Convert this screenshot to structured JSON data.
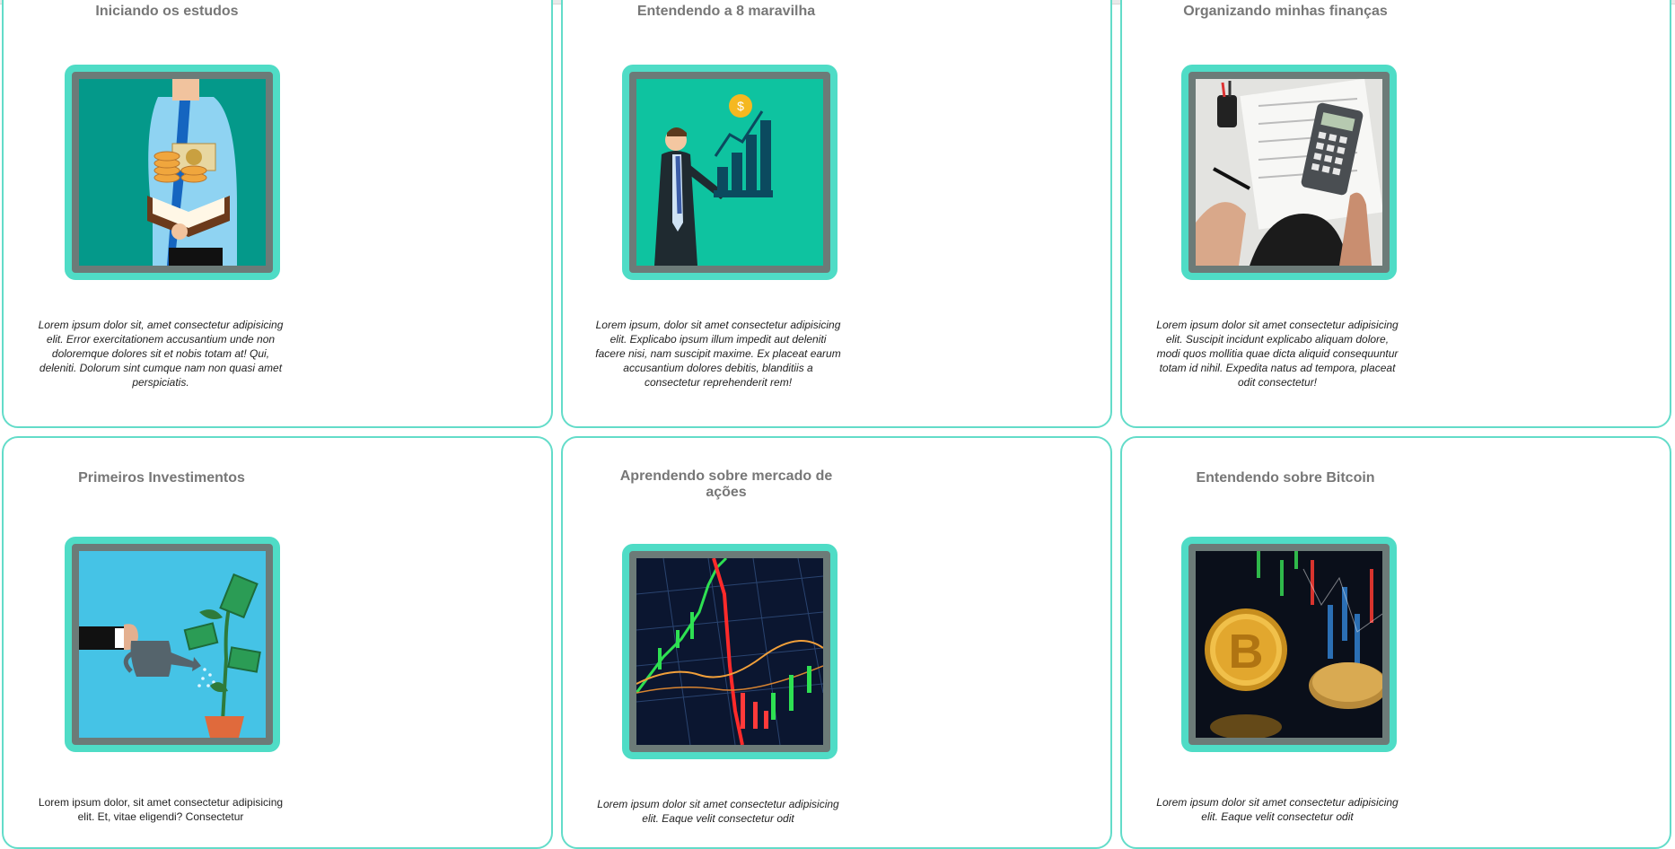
{
  "cards": [
    {
      "title": "Iniciando os estudos",
      "image": "man-with-book-and-coins-illustration",
      "text": "Lorem ipsum dolor sit, amet consectetur adipisicing elit. Error exercitationem accusantium unde non doloremque dolores sit et nobis totam at! Qui, deleniti. Dolorum sint cumque nam non quasi amet perspiciatis."
    },
    {
      "title": "Entendendo a 8 maravilha",
      "image": "businessman-growth-chart-illustration",
      "text": "Lorem ipsum, dolor sit amet consectetur adipisicing elit. Explicabo ipsum illum impedit aut deleniti facere nisi, nam suscipit maxime. Ex placeat earum accusantium dolores debitis, blanditiis a consectetur reprehenderit rem!"
    },
    {
      "title": "Organizando minhas finanças",
      "image": "hands-calculator-photo",
      "text": "Lorem ipsum dolor sit amet consectetur adipisicing elit. Suscipit incidunt explicabo aliquam dolore, modi quos mollitia quae dicta aliquid consequuntur totam id nihil. Expedita natus ad tempora, placeat odit consectetur!"
    },
    {
      "title": "Primeiros Investimentos",
      "image": "watering-money-plant-illustration",
      "text": "Lorem ipsum dolor, sit amet consectetur adipisicing elit. Et, vitae eligendi? Consectetur"
    },
    {
      "title": "Aprendendo sobre mercado de ações",
      "image": "stock-market-candlestick-photo",
      "text": "Lorem ipsum dolor sit amet consectetur adipisicing elit. Eaque velit consectetur odit"
    },
    {
      "title": "Entendendo sobre Bitcoin",
      "image": "bitcoin-coin-photo",
      "text": "Lorem ipsum dolor sit amet consectetur adipisicing elit. Eaque velit consectetur odit"
    }
  ],
  "colors": {
    "card_border": "#63dcc9",
    "frame_border": "#4fdcc6",
    "frame_inner": "#6c7b78",
    "title": "#777777"
  }
}
